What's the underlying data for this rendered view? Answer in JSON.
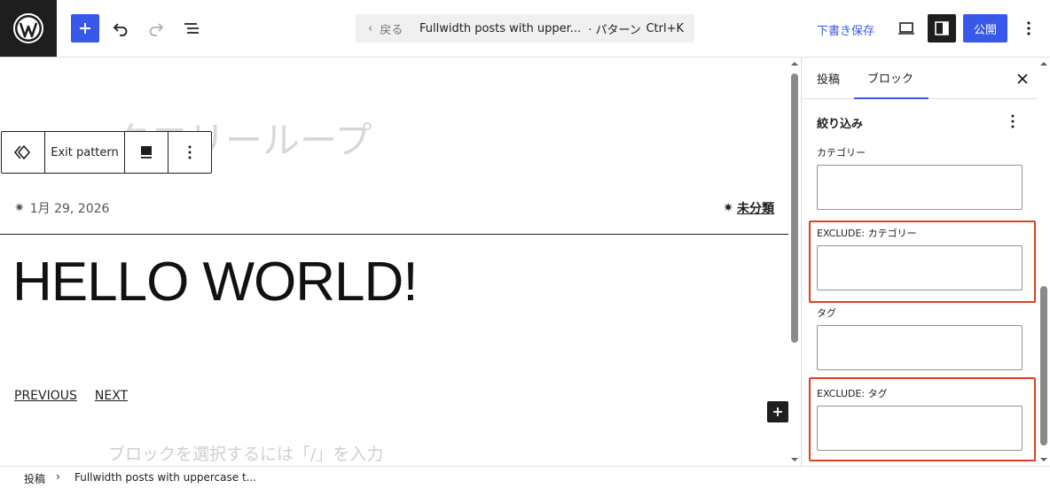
{
  "header": {
    "command_bar": {
      "back_label": "戻る",
      "title": "Fullwidth posts with upper...",
      "type_label": "· パターン",
      "shortcut": "Ctrl+K"
    },
    "save_draft_label": "下書き保存",
    "publish_label": "公開"
  },
  "canvas": {
    "ghost_title": "クエリーループ",
    "block_toolbar": {
      "exit_label": "Exit pattern"
    },
    "post_date": "1月 29, 2026",
    "post_category": "未分類",
    "post_title": "HELLO WORLD!",
    "nav": {
      "previous": "PREVIOUS",
      "next": "NEXT"
    },
    "placeholder": "ブロックを選択するには「/」を入力"
  },
  "sidebar": {
    "tabs": [
      {
        "label": "投稿",
        "active": false
      },
      {
        "label": "ブロック",
        "active": true
      }
    ],
    "panel": {
      "title": "絞り込み",
      "fields": [
        {
          "label": "カテゴリー",
          "value": "",
          "highlighted": false
        },
        {
          "label": "EXCLUDE: カテゴリー",
          "value": "",
          "highlighted": true
        },
        {
          "label": "タグ",
          "value": "",
          "highlighted": false
        },
        {
          "label": "EXCLUDE: タグ",
          "value": "",
          "highlighted": true
        }
      ]
    }
  },
  "footer": {
    "breadcrumb": [
      "投稿",
      "Fullwidth posts with uppercase t..."
    ]
  },
  "colors": {
    "accent": "#3858e9",
    "highlight": "#e0401f",
    "dark": "#1e1e1e"
  }
}
